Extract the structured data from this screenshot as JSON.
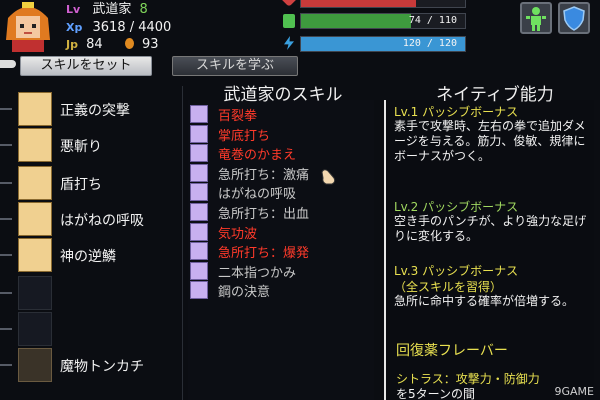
{
  "player": {
    "class_name": "武道家",
    "level_label": "Lv",
    "level": "8",
    "xp_label": "Xp",
    "xp": "3618 / 4400",
    "jp_label": "Jp",
    "jp": "84",
    "gold": "93"
  },
  "bars": [
    {
      "id": "top",
      "text": "",
      "fill": 0.7,
      "color": "#d04040"
    },
    {
      "id": "green",
      "text": "74 / 110",
      "fill": 0.67,
      "color": "#40a040"
    },
    {
      "id": "blue",
      "text": "120 / 120",
      "fill": 1.0,
      "color": "#3a9ad8"
    }
  ],
  "tabs": {
    "set_skill": "スキルをセット",
    "learn_skill": "スキルを学ぶ"
  },
  "slots": [
    {
      "label": "正義の突撃",
      "filled": true
    },
    {
      "label": "悪斬り",
      "filled": true
    },
    {
      "label": "盾打ち",
      "filled": true
    },
    {
      "label": "はがねの呼吸",
      "filled": true
    },
    {
      "label": "神の逆鱗",
      "filled": true
    },
    {
      "label": "",
      "filled": false
    },
    {
      "label": "",
      "filled": false
    },
    {
      "label": "魔物トンカチ",
      "filled": true
    }
  ],
  "skill_list": {
    "title": "武道家のスキル",
    "items": [
      {
        "name": "百裂拳",
        "color": "red"
      },
      {
        "name": "掌底打ち",
        "color": "red"
      },
      {
        "name": "竜巻のかまえ",
        "color": "red"
      },
      {
        "name": "急所打ち：激痛",
        "color": "grey"
      },
      {
        "name": "はがねの呼吸",
        "color": "grey"
      },
      {
        "name": "急所打ち：出血",
        "color": "grey"
      },
      {
        "name": "気功波",
        "color": "red"
      },
      {
        "name": "急所打ち：爆発",
        "color": "red"
      },
      {
        "name": "二本指つかみ",
        "color": "grey"
      },
      {
        "name": "鋼の決意",
        "color": "grey"
      }
    ]
  },
  "native": {
    "title": "ネイティブ能力",
    "lv1_head": "Lv.1 パッシブボーナス",
    "lv1_body": "素手で攻撃時、左右の拳で追加ダメージを与える。筋力、俊敏、規律にボーナスがつく。",
    "lv2_head": "Lv.2 パッシブボーナス",
    "lv2_body": "空き手のパンチが、より強力な足げりに変化する。",
    "lv3_head": "Lv.3 パッシブボーナス",
    "lv3_sub": "（全スキルを習得）",
    "lv3_body": "急所に命中する確率が倍増する。",
    "flavor_title": "回復薬フレーバー",
    "flavor_line1": "シトラス：攻撃力・防御力",
    "flavor_line2": "を5ターンの間"
  },
  "watermark": "9GAME",
  "icons": {
    "status_button": "person-icon",
    "defense_button": "shield-icon",
    "jp_icon": "jp-coin-icon",
    "gold_icon": "gold-coin-icon"
  }
}
